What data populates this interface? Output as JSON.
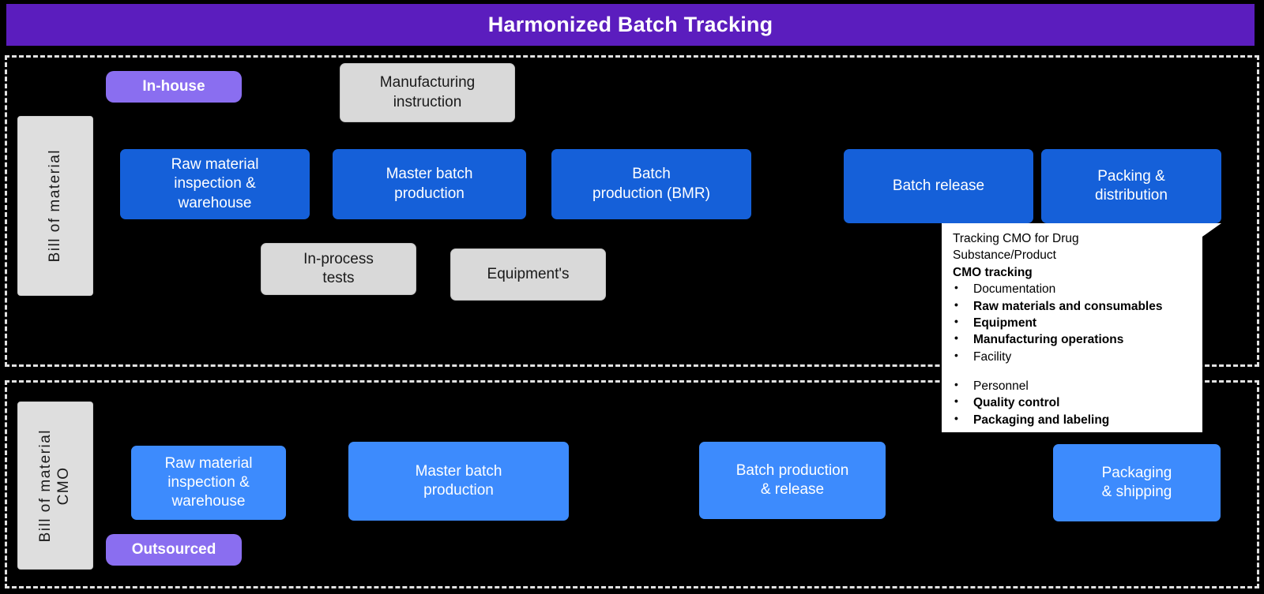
{
  "header": {
    "title": "Harmonized Batch Tracking",
    "background_color": "#5b1dbe",
    "text_color": "#ffffff"
  },
  "colors": {
    "title_purple": "#5b1dbe",
    "badge_purple": "#8a6ef0",
    "process_blue_dark": "#1560d9",
    "process_blue_light": "#3d8bfd",
    "document_gray": "#d9d9d9",
    "lane_border": "#e2e2e2",
    "canvas": "#000000",
    "callout_bg": "#ffffff"
  },
  "lanes": {
    "inhouse": {
      "badge": "In-house",
      "bill_of_material": "Bill of material",
      "documents": {
        "manufacturing_instruction": "Manufacturing\ninstruction",
        "in_process_tests": "In-process\ntests",
        "equipment": "Equipment's"
      },
      "steps": [
        {
          "label": "Raw material\ninspection &\nwarehouse"
        },
        {
          "label": "Master batch\nproduction"
        },
        {
          "label": "Batch\nproduction (BMR)"
        },
        {
          "label": "Batch release"
        },
        {
          "label": "Packing &\ndistribution"
        }
      ]
    },
    "cmo": {
      "badge": "Outsourced",
      "bill_of_material": "Bill of material\nCMO",
      "steps": [
        {
          "label": "Raw material\ninspection &\nwarehouse"
        },
        {
          "label": "Master batch\nproduction"
        },
        {
          "label": "Batch production\n& release"
        },
        {
          "label": "Packaging\n& shipping"
        }
      ]
    }
  },
  "callout": {
    "intro": "Tracking CMO for Drug\nSubstance/Product",
    "heading": "CMO tracking",
    "items_group_1": [
      {
        "text": "Documentation",
        "bold": false
      },
      {
        "text": "Raw materials and consumables",
        "bold": true
      },
      {
        "text": "Equipment",
        "bold": true
      },
      {
        "text": "Manufacturing operations",
        "bold": true
      },
      {
        "text": "Facility",
        "bold": false
      }
    ],
    "items_group_2": [
      {
        "text": "Personnel",
        "bold": false
      },
      {
        "text": "Quality control",
        "bold": true
      },
      {
        "text": "Packaging and labeling",
        "bold": true
      }
    ]
  }
}
